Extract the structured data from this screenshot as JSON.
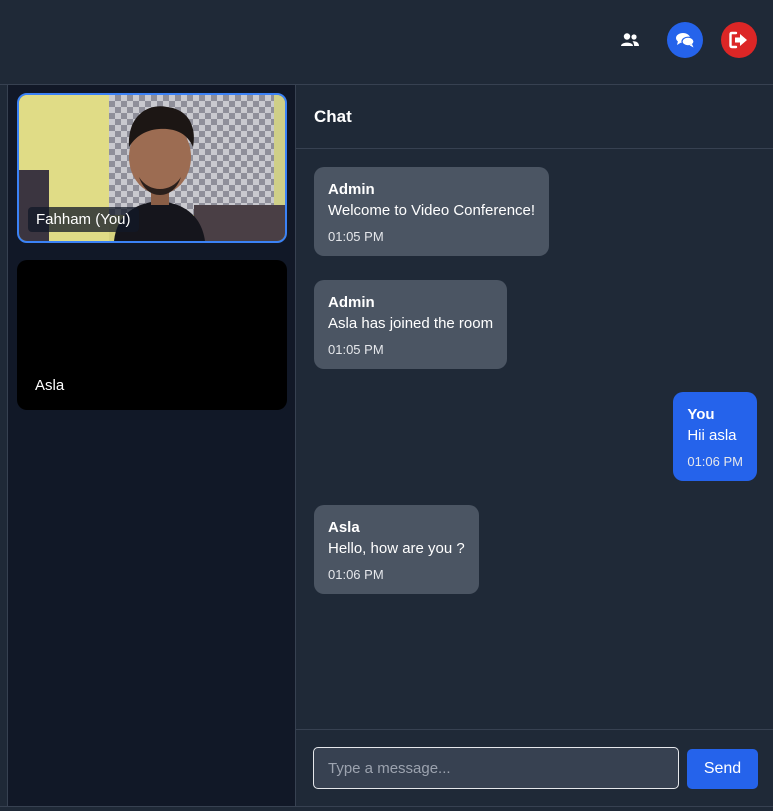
{
  "topbar": {
    "icons": [
      "users-icon",
      "chat-bubbles-icon",
      "sign-out-icon"
    ],
    "colors": {
      "chat_active": "#2563eb",
      "leave": "#dc2626"
    }
  },
  "participants": [
    {
      "name": "Fahham (You)",
      "is_self": true
    },
    {
      "name": "Asla",
      "is_self": false
    }
  ],
  "chat": {
    "title": "Chat",
    "messages": [
      {
        "sender": "Admin",
        "text": "Welcome to Video Conference!",
        "time": "01:05 PM",
        "mine": false
      },
      {
        "sender": "Admin",
        "text": "Asla has joined the room",
        "time": "01:05 PM",
        "mine": false
      },
      {
        "sender": "You",
        "text": "Hii asla",
        "time": "01:06 PM",
        "mine": true
      },
      {
        "sender": "Asla",
        "text": "Hello, how are you ?",
        "time": "01:06 PM",
        "mine": false
      }
    ],
    "input": {
      "placeholder": "Type a message...",
      "value": ""
    },
    "send_label": "Send"
  }
}
